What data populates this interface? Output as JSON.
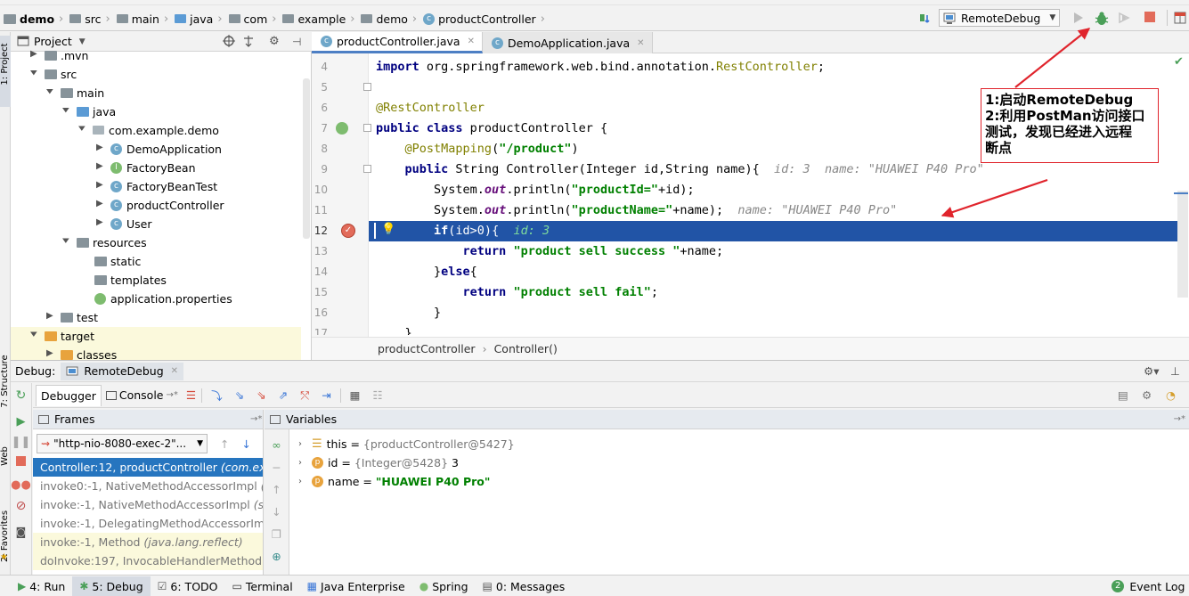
{
  "breadcrumbs": [
    "demo",
    "src",
    "main",
    "java",
    "com",
    "example",
    "demo",
    "productController"
  ],
  "run_config": "RemoteDebug",
  "project_panel": {
    "title": "Project"
  },
  "left_strip": {
    "project": "1: Project",
    "structure": "7: Structure",
    "web": "Web",
    "favorites": "2: Favorites"
  },
  "tree": [
    {
      "label": ".mvn",
      "indent": 38,
      "icon": "folder",
      "arrow": "right"
    },
    {
      "label": "src",
      "indent": 38,
      "icon": "folder",
      "arrow": "down"
    },
    {
      "label": "main",
      "indent": 56,
      "icon": "folder",
      "arrow": "down"
    },
    {
      "label": "java",
      "indent": 74,
      "icon": "folder-blue",
      "arrow": "down"
    },
    {
      "label": "com.example.demo",
      "indent": 92,
      "icon": "package",
      "arrow": "down"
    },
    {
      "label": "DemoApplication",
      "indent": 112,
      "icon": "class-spring",
      "arrow": "right"
    },
    {
      "label": "FactoryBean",
      "indent": 112,
      "icon": "interface",
      "arrow": "right"
    },
    {
      "label": "FactoryBeanTest",
      "indent": 112,
      "icon": "class",
      "arrow": "right"
    },
    {
      "label": "productController",
      "indent": 112,
      "icon": "class",
      "arrow": "right"
    },
    {
      "label": "User",
      "indent": 112,
      "icon": "class",
      "arrow": "right"
    },
    {
      "label": "resources",
      "indent": 74,
      "icon": "folder-res",
      "arrow": "down"
    },
    {
      "label": "static",
      "indent": 94,
      "icon": "folder",
      "arrow": ""
    },
    {
      "label": "templates",
      "indent": 94,
      "icon": "folder",
      "arrow": ""
    },
    {
      "label": "application.properties",
      "indent": 94,
      "icon": "props",
      "arrow": ""
    },
    {
      "label": "test",
      "indent": 56,
      "icon": "folder",
      "arrow": "right"
    },
    {
      "label": "target",
      "indent": 38,
      "icon": "folder-org",
      "arrow": "down"
    },
    {
      "label": "classes",
      "indent": 56,
      "icon": "folder-org",
      "arrow": "right"
    }
  ],
  "editor_tabs": [
    {
      "label": "productController.java",
      "active": true
    },
    {
      "label": "DemoApplication.java",
      "active": false
    }
  ],
  "code_lines": [
    {
      "n": "4",
      "html": "<span class='kw'>import</span> org.springframework.web.bind.annotation.<span style='color:#808000'>RestController</span>;"
    },
    {
      "n": "5",
      "html": ""
    },
    {
      "n": "6",
      "html": "<span class='ann'>@RestController</span>"
    },
    {
      "n": "7",
      "html": "<span class='kw'>public class</span> productController {"
    },
    {
      "n": "8",
      "html": "    <span class='ann'>@PostMapping</span>(<span class='str'>\"/product\"</span>)"
    },
    {
      "n": "9",
      "html": "    <span class='kw'>public</span> String Controller(Integer id,String name){  <span class='hint'>id: 3  name: \"HUAWEI P40 Pro\"</span>"
    },
    {
      "n": "10",
      "html": "        System.<b style='color:#660e7a;font-style:italic'>out</b>.println(<span class='str'>\"productId=\"</span>+id);"
    },
    {
      "n": "11",
      "html": "        System.<b style='color:#660e7a;font-style:italic'>out</b>.println(<span class='str'>\"productName=\"</span>+name);  <span class='hint'>name: \"HUAWEI P40 Pro\"</span>"
    },
    {
      "n": "12",
      "html": "        <b>if</b>(id&gt;0){  <span class='hint2' style='color:#7fdc9c'>id: 3</span>",
      "active": true
    },
    {
      "n": "13",
      "html": "            <span class='kw'>return</span> <span class='str'>\"product sell success \"</span>+name;"
    },
    {
      "n": "14",
      "html": "        }<span class='kw'>else</span>{"
    },
    {
      "n": "15",
      "html": "            <span class='kw'>return</span> <span class='str'>\"product sell fail\"</span>;"
    },
    {
      "n": "16",
      "html": "        }"
    },
    {
      "n": "17",
      "html": "    }"
    }
  ],
  "editor_breadcrumb": [
    "productController",
    "Controller()"
  ],
  "annotation": {
    "line1": "1:启动RemoteDebug",
    "line2": "2:利用PostMan访问接口",
    "line3": "测试，发现已经进入远程",
    "line4": "断点"
  },
  "debug": {
    "label": "Debug:",
    "session": "RemoteDebug",
    "tabs": [
      "Debugger",
      "Console"
    ],
    "frames_title": "Frames",
    "variables_title": "Variables",
    "thread": "\"http-nio-8080-exec-2\"...",
    "frames": [
      {
        "main": "Controller:12, productController ",
        "pkg": "(com.exam",
        "selected": true
      },
      {
        "main": "invoke0:-1, NativeMethodAccessorImpl ",
        "pkg": "(su"
      },
      {
        "main": "invoke:-1, NativeMethodAccessorImpl ",
        "pkg": "(sun"
      },
      {
        "main": "invoke:-1, DelegatingMethodAccessorImpl",
        "pkg": ""
      },
      {
        "main": "invoke:-1, Method ",
        "pkg": "(java.lang.reflect)"
      },
      {
        "main": "doInvoke:197, InvocableHandlerMethod ",
        "pkg": "(o"
      }
    ],
    "variables": [
      {
        "icon": "list",
        "name": "this",
        "eq": " = ",
        "value": "{productController@5427}",
        "extra": ""
      },
      {
        "icon": "p",
        "name": "id",
        "eq": " = ",
        "value": "{Integer@5428} ",
        "extra": "3"
      },
      {
        "icon": "p",
        "name": "name",
        "eq": " = ",
        "value": "",
        "extra": "\"HUAWEI P40 Pro\""
      }
    ]
  },
  "statusbar": [
    {
      "label": "4: Run",
      "name": "run-tab"
    },
    {
      "label": "5: Debug",
      "name": "debug-tab",
      "active": true
    },
    {
      "label": "6: TODO",
      "name": "todo-tab"
    },
    {
      "label": "Terminal",
      "name": "terminal-tab"
    },
    {
      "label": "Java Enterprise",
      "name": "java-enterprise-tab"
    },
    {
      "label": "Spring",
      "name": "spring-tab"
    },
    {
      "label": "0: Messages",
      "name": "messages-tab"
    }
  ],
  "event_log": {
    "count": "2",
    "label": "Event Log"
  },
  "colors": {
    "accent": "#2154a6",
    "selected": "#2675bf",
    "annotation_border": "#e0242c",
    "arrow": "#e0242c"
  }
}
